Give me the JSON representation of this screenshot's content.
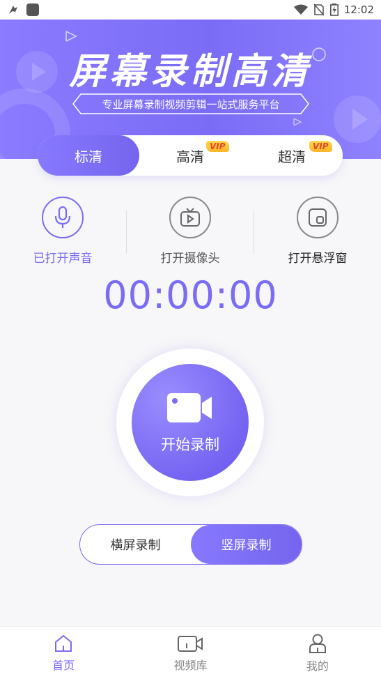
{
  "status": {
    "time": "12:02"
  },
  "hero": {
    "title": "屏幕录制高清",
    "subtitle": "专业屏幕录制视频剪辑一站式服务平台"
  },
  "quality": {
    "options": [
      {
        "label": "标清",
        "selected": true,
        "vip": false
      },
      {
        "label": "高清",
        "selected": false,
        "vip": true
      },
      {
        "label": "超清",
        "selected": false,
        "vip": true
      }
    ],
    "vip_badge": "VIP"
  },
  "controls": {
    "audio": "已打开声音",
    "camera": "打开摄像头",
    "floating": "打开悬浮窗"
  },
  "timer": "00:00:00",
  "record": {
    "label": "开始录制"
  },
  "orientation": {
    "options": [
      {
        "label": "横屏录制",
        "selected": false
      },
      {
        "label": "竖屏录制",
        "selected": true
      }
    ]
  },
  "tabs": [
    {
      "label": "首页",
      "active": true
    },
    {
      "label": "视频库",
      "active": false
    },
    {
      "label": "我的",
      "active": false
    }
  ],
  "colors": {
    "accent": "#7b6cf6",
    "vip_bg": "#ffc73a",
    "vip_text": "#e04a2c"
  }
}
